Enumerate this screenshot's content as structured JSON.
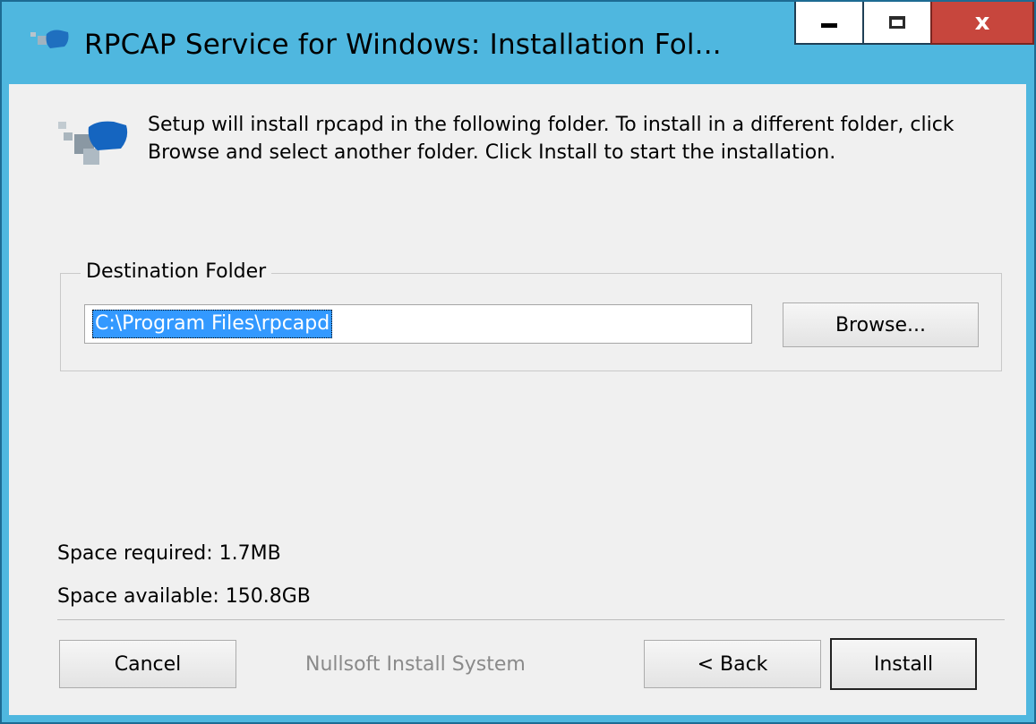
{
  "window": {
    "title": "RPCAP Service for Windows: Installation Fol...",
    "close_glyph": "x"
  },
  "intro_text": "Setup will install rpcapd in the following folder. To install in a different folder, click Browse and select another folder. Click Install to start the installation.",
  "destination": {
    "group_label": "Destination Folder",
    "path_value": "C:\\Program Files\\rpcapd",
    "browse_label": "Browse..."
  },
  "space": {
    "required": "Space required: 1.7MB",
    "available": "Space available: 150.8GB"
  },
  "footer": {
    "cancel_label": "Cancel",
    "branding": "Nullsoft Install System",
    "back_label": "< Back",
    "install_label": "Install"
  },
  "colors": {
    "title_bar": "#4fb7df",
    "close_button": "#c7463d",
    "selection": "#3399ff",
    "dialog_bg": "#f0f0f0"
  },
  "icons": [
    "app-icon",
    "installer-header-icon",
    "minimize-icon",
    "maximize-icon",
    "close-icon"
  ]
}
